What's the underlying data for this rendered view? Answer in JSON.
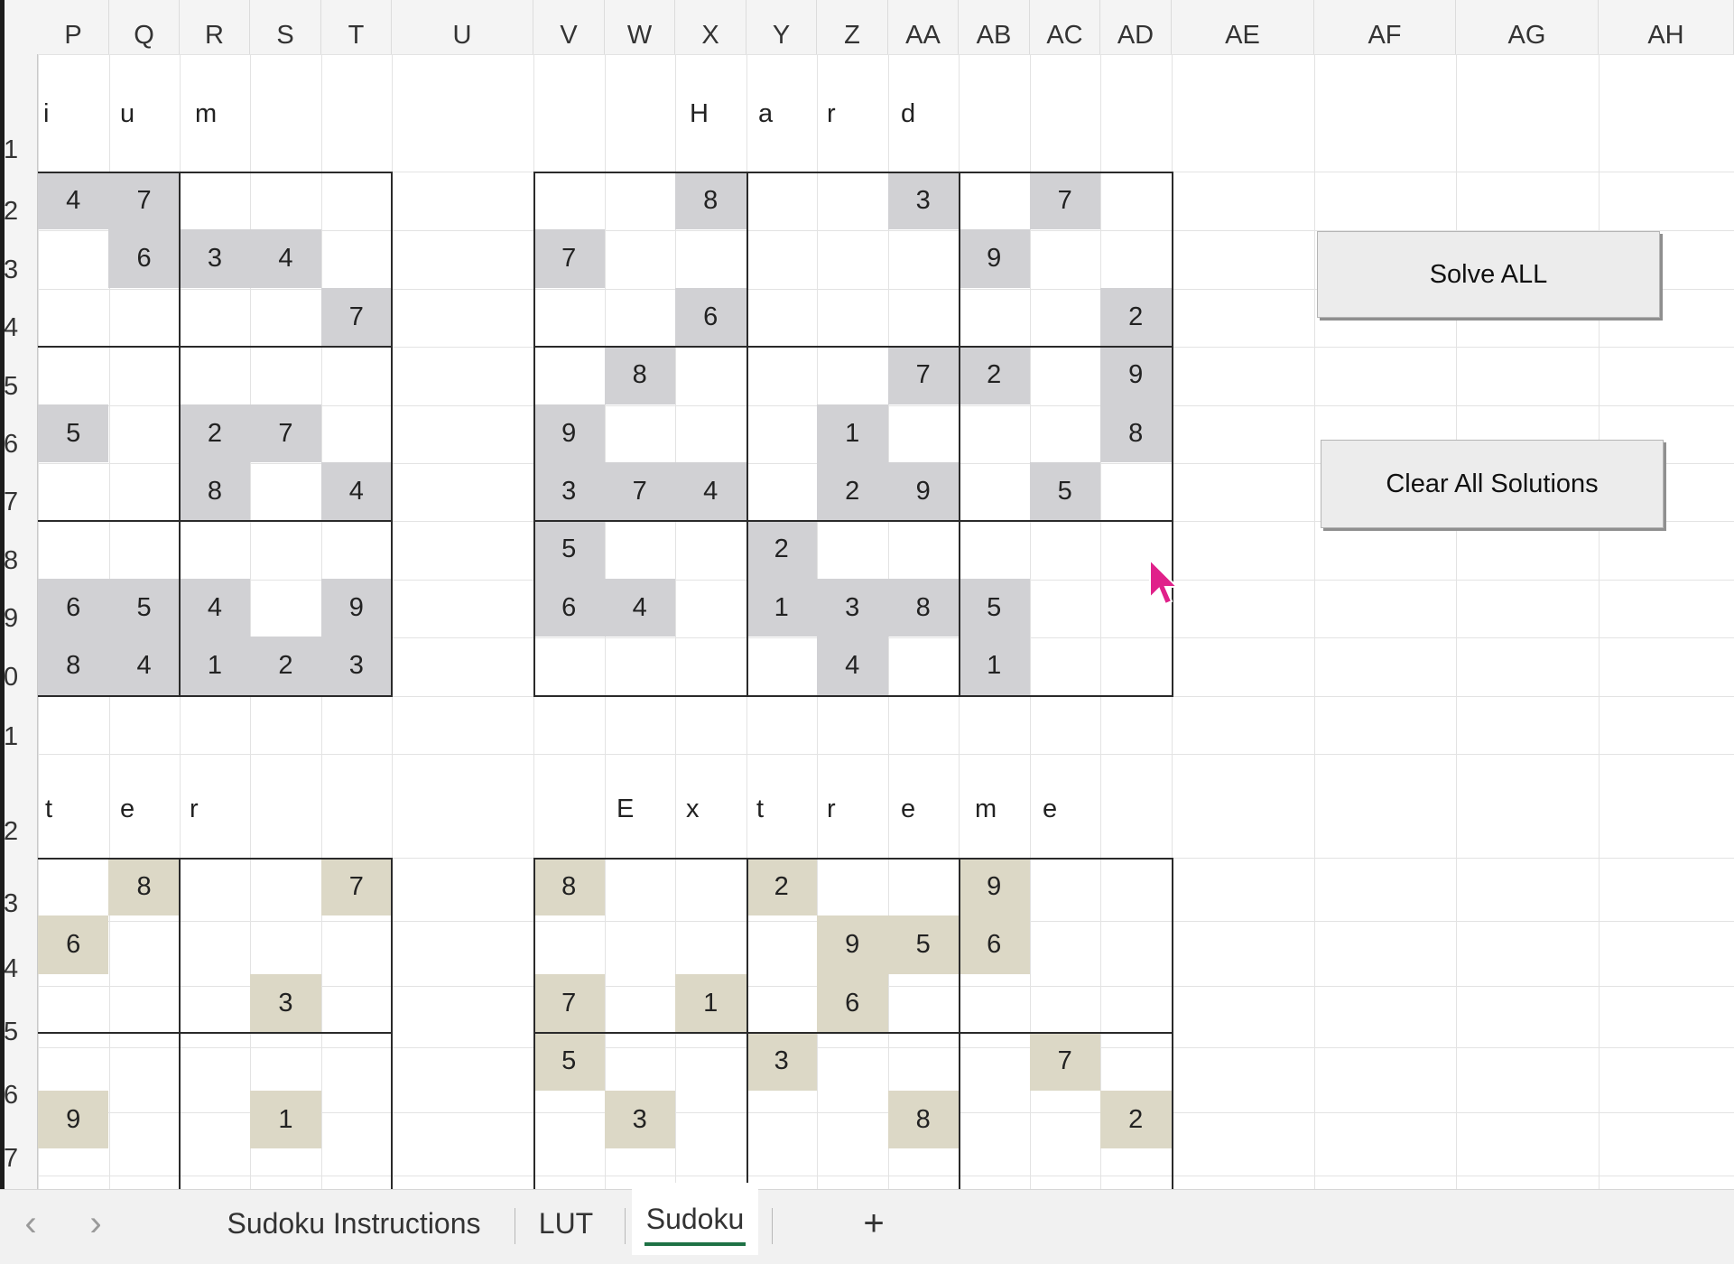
{
  "columns": [
    "P",
    "Q",
    "R",
    "S",
    "T",
    "U",
    "V",
    "W",
    "X",
    "Y",
    "Z",
    "AA",
    "AB",
    "AC",
    "AD",
    "AE",
    "AF",
    "AG",
    "AH"
  ],
  "rows": [
    {
      "label": "1"
    },
    {
      "label": "2"
    },
    {
      "label": "3"
    },
    {
      "label": "4"
    },
    {
      "label": "5"
    },
    {
      "label": "6"
    },
    {
      "label": "7"
    },
    {
      "label": "8"
    },
    {
      "label": "9"
    },
    {
      "label": "0"
    },
    {
      "label": "1"
    },
    {
      "label": "2"
    },
    {
      "label": "3"
    },
    {
      "label": "4"
    },
    {
      "label": "5"
    },
    {
      "label": "6"
    },
    {
      "label": "7"
    }
  ],
  "puzzles": [
    {
      "title_chars": [
        "i",
        "u",
        "m"
      ],
      "shade": "gray",
      "cells": [
        [
          "4",
          "7",
          "",
          "",
          "",
          ""
        ],
        [
          "",
          "6",
          "3",
          "4",
          "",
          ""
        ],
        [
          "",
          "",
          "",
          "",
          "7",
          ""
        ],
        [
          "",
          "",
          "",
          "",
          "",
          ""
        ],
        [
          "5",
          "",
          "2",
          "7",
          "",
          ""
        ],
        [
          "",
          "",
          "8",
          "",
          "4",
          ""
        ],
        [
          "",
          "",
          "",
          "",
          "",
          ""
        ],
        [
          "6",
          "5",
          "4",
          "",
          "9",
          ""
        ],
        [
          "8",
          "4",
          "1",
          "2",
          "3",
          ""
        ]
      ],
      "shaded": [
        [
          1,
          1,
          0,
          0,
          0
        ],
        [
          0,
          1,
          1,
          1,
          0
        ],
        [
          0,
          0,
          0,
          0,
          1
        ],
        [
          0,
          0,
          0,
          0,
          0
        ],
        [
          1,
          0,
          1,
          1,
          0
        ],
        [
          0,
          0,
          1,
          0,
          1
        ],
        [
          0,
          0,
          0,
          0,
          0
        ],
        [
          1,
          1,
          1,
          0,
          1
        ],
        [
          1,
          1,
          1,
          1,
          1
        ]
      ]
    },
    {
      "title_chars": [
        "H",
        "a",
        "r",
        "d"
      ],
      "shade": "gray",
      "cells": [
        [
          "",
          "",
          "8",
          "",
          "",
          "3",
          "",
          "7",
          ""
        ],
        [
          "7",
          "",
          "",
          "",
          "",
          "",
          "9",
          "",
          ""
        ],
        [
          "",
          "",
          "6",
          "",
          "",
          "",
          "",
          "",
          "2"
        ],
        [
          "",
          "8",
          "",
          "",
          "",
          "7",
          "2",
          "",
          "9"
        ],
        [
          "9",
          "",
          "",
          "",
          "1",
          "",
          "",
          "",
          "8"
        ],
        [
          "3",
          "7",
          "4",
          "",
          "2",
          "9",
          "",
          "5",
          ""
        ],
        [
          "5",
          "",
          "",
          "2",
          "",
          "",
          "",
          "",
          ""
        ],
        [
          "6",
          "4",
          "",
          "1",
          "3",
          "8",
          "5",
          "",
          ""
        ],
        [
          "",
          "",
          "",
          "",
          "4",
          "",
          "1",
          "",
          ""
        ]
      ],
      "shaded": [
        [
          0,
          0,
          1,
          0,
          0,
          1,
          0,
          1,
          0
        ],
        [
          1,
          0,
          0,
          0,
          0,
          0,
          1,
          0,
          0
        ],
        [
          0,
          0,
          1,
          0,
          0,
          0,
          0,
          0,
          1
        ],
        [
          0,
          1,
          0,
          0,
          0,
          1,
          1,
          0,
          1
        ],
        [
          1,
          0,
          0,
          0,
          1,
          0,
          0,
          0,
          1
        ],
        [
          1,
          1,
          1,
          0,
          1,
          1,
          0,
          1,
          0
        ],
        [
          1,
          0,
          0,
          1,
          0,
          0,
          0,
          0,
          0
        ],
        [
          1,
          1,
          0,
          1,
          1,
          1,
          1,
          0,
          0
        ],
        [
          0,
          0,
          0,
          0,
          1,
          0,
          1,
          0,
          0
        ]
      ]
    },
    {
      "title_chars": [
        "t",
        "e",
        "r"
      ],
      "shade": "tan",
      "cells": [
        [
          "",
          "8",
          "",
          "",
          "7"
        ],
        [
          "6",
          "",
          "",
          "",
          ""
        ],
        [
          "",
          "",
          "",
          "3",
          ""
        ],
        [
          "",
          "",
          "",
          "",
          ""
        ],
        [
          "9",
          "",
          "",
          "1",
          ""
        ]
      ],
      "shaded": [
        [
          0,
          1,
          0,
          0,
          1
        ],
        [
          1,
          0,
          0,
          0,
          0
        ],
        [
          0,
          0,
          0,
          1,
          0
        ],
        [
          0,
          0,
          0,
          0,
          0
        ],
        [
          1,
          0,
          0,
          1,
          0
        ]
      ]
    },
    {
      "title_chars": [
        "E",
        "x",
        "t",
        "r",
        "e",
        "m",
        "e"
      ],
      "shade": "tan",
      "cells": [
        [
          "8",
          "",
          "",
          "2",
          "",
          "",
          "9",
          "",
          ""
        ],
        [
          "",
          "",
          "",
          "",
          "9",
          "5",
          "6",
          "",
          ""
        ],
        [
          "7",
          "",
          "1",
          "",
          "6",
          "",
          "",
          "",
          ""
        ],
        [
          "5",
          "",
          "",
          "3",
          "",
          "",
          "",
          "7",
          ""
        ],
        [
          "",
          "3",
          "",
          "",
          "",
          "8",
          "",
          "",
          "2"
        ]
      ],
      "shaded": [
        [
          1,
          0,
          0,
          1,
          0,
          0,
          1,
          0,
          0
        ],
        [
          0,
          0,
          0,
          0,
          1,
          1,
          1,
          0,
          0
        ],
        [
          1,
          0,
          1,
          0,
          1,
          0,
          0,
          0,
          0
        ],
        [
          1,
          0,
          0,
          1,
          0,
          0,
          0,
          1,
          0
        ],
        [
          0,
          1,
          0,
          0,
          0,
          1,
          0,
          0,
          1
        ]
      ]
    }
  ],
  "buttons": {
    "solve_all": "Solve ALL",
    "clear_all": "Clear All Solutions"
  },
  "tabs": {
    "prev": "‹",
    "next": "›",
    "items": [
      "Sudoku Instructions",
      "LUT",
      "Sudoku"
    ],
    "active": "Sudoku",
    "add": "+"
  },
  "colors": {
    "gray_fill": "#d1d1d4",
    "tan_fill": "#dcd8c6",
    "active_tab_underline": "#1e7145",
    "cursor": "#e0218a"
  }
}
